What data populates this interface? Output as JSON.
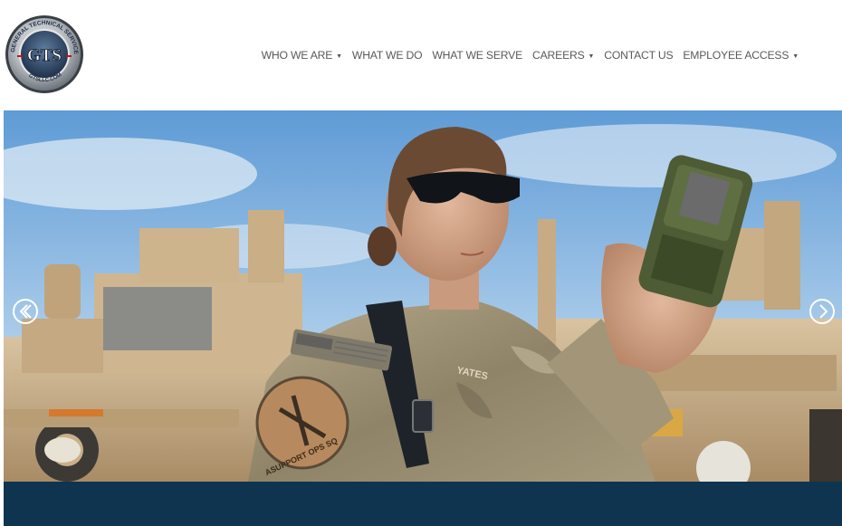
{
  "logo": {
    "ring_text": "GENERAL TECHNICAL SERVICES, LLC",
    "center_text": "GTS",
    "url_text": "GTSLLC.COM"
  },
  "nav": {
    "items": [
      {
        "label": "WHO WE ARE",
        "dropdown": true
      },
      {
        "label": "WHAT WE DO",
        "dropdown": false
      },
      {
        "label": "WHAT WE SERVE",
        "dropdown": false
      },
      {
        "label": "CAREERS",
        "dropdown": true
      },
      {
        "label": "CONTACT US",
        "dropdown": false
      },
      {
        "label": "EMPLOYEE ACCESS",
        "dropdown": true
      }
    ]
  },
  "hero": {
    "patch_text": "ASUPPORT OPS SQ",
    "name_tape": "YATES",
    "prev_icon": "chevron-left-circle-icon",
    "next_icon": "chevron-right-circle-icon"
  },
  "colors": {
    "nav_text": "#5a5a5a",
    "footer_band": "#0e3450",
    "sky": "#7fb1de"
  }
}
